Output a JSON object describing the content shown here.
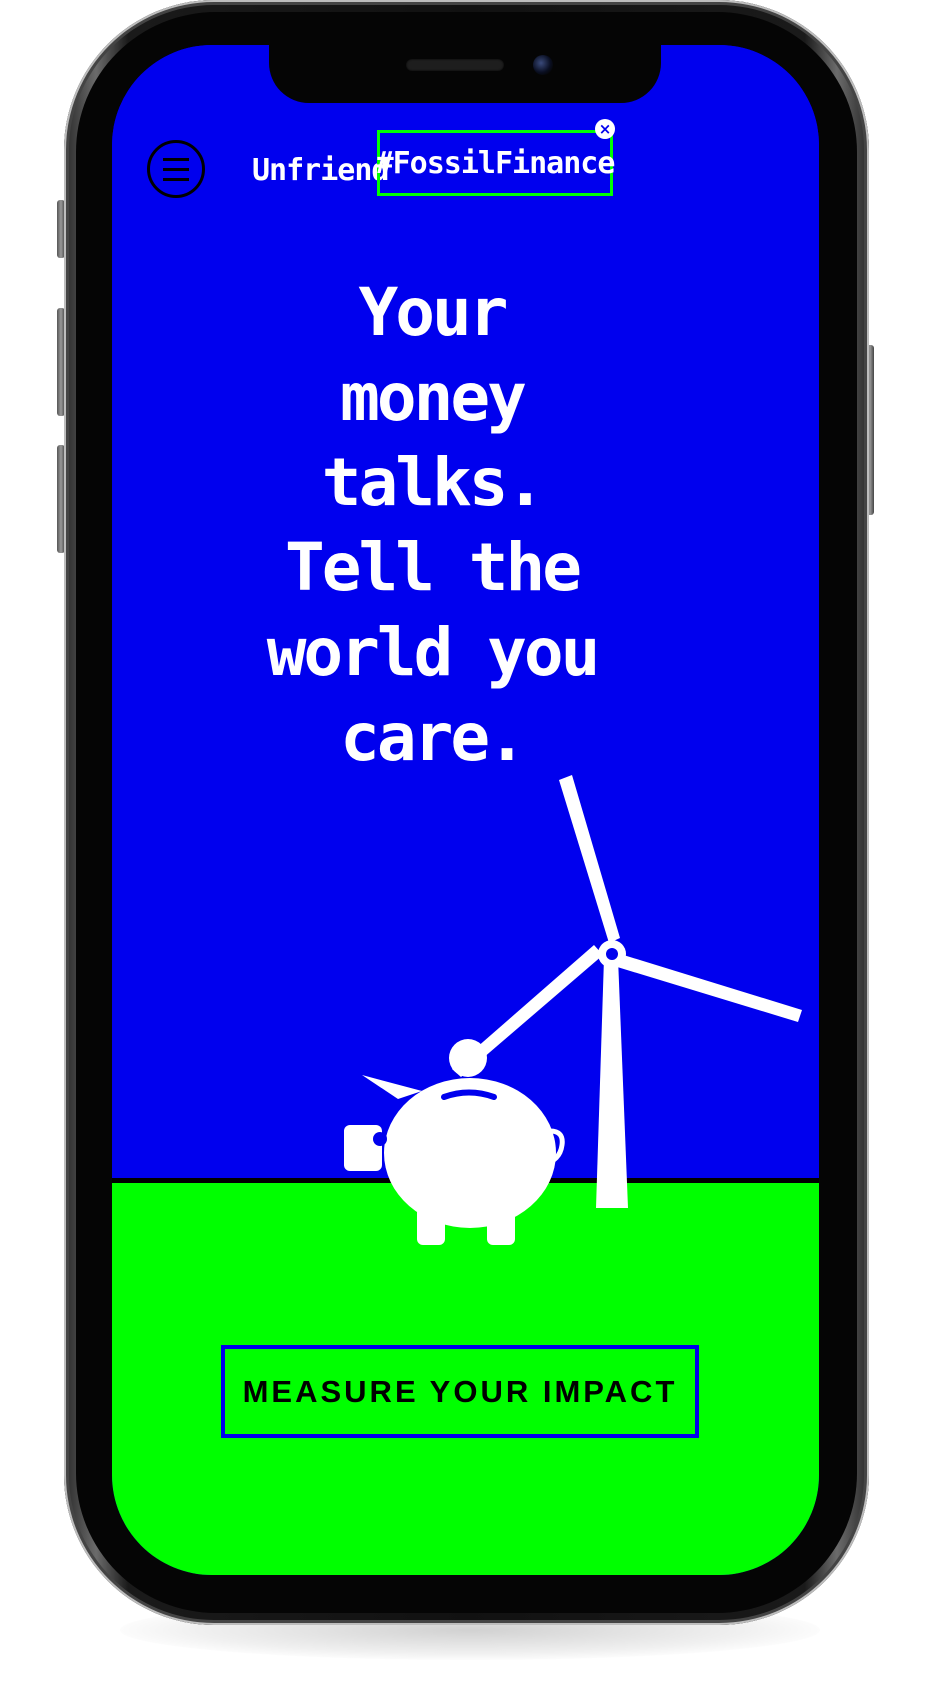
{
  "header": {
    "brand_word": "Unfriend",
    "brand_tag": "#FossilFinance",
    "tag_close_glyph": "×",
    "menu_icon": "hamburger-menu-icon"
  },
  "hero": {
    "headline_lines": [
      "Your",
      "money",
      "talks.",
      "Tell the",
      "world you",
      "care."
    ]
  },
  "illustration": {
    "icons": [
      "piggy-bank-icon",
      "coin-icon",
      "wind-turbine-icon"
    ]
  },
  "cta": {
    "label": "MEASURE YOUR IMPACT"
  },
  "colors": {
    "sky": "#0000ee",
    "ground": "#00ff00",
    "text": "#ffffff",
    "accent_border": "#00ff00",
    "cta_border": "#0000ee"
  }
}
